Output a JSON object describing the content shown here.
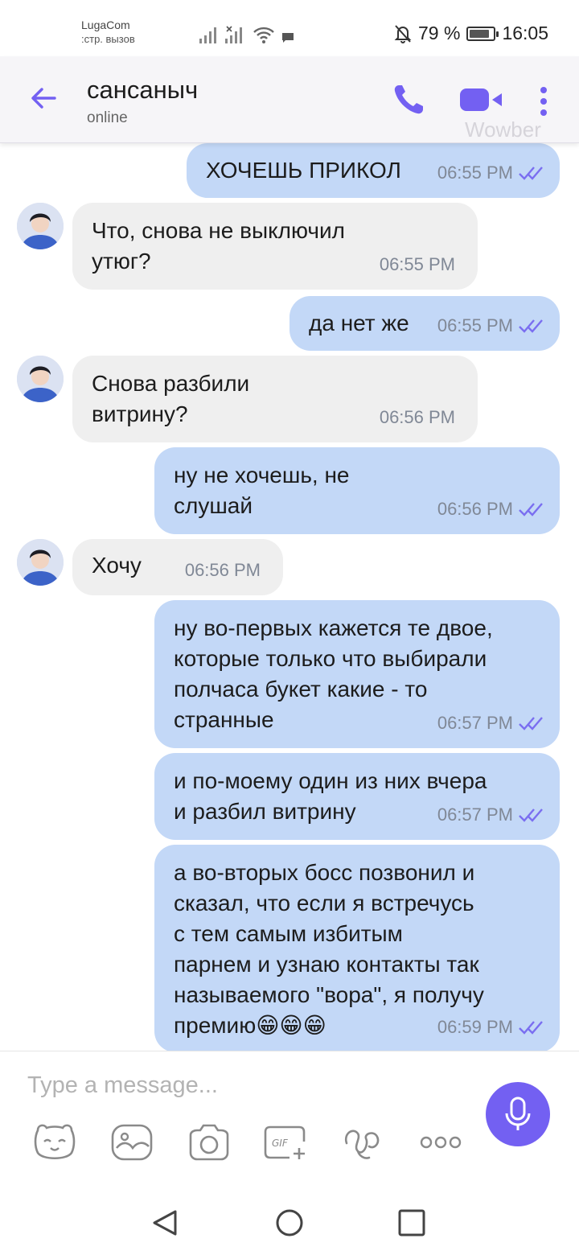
{
  "status_bar": {
    "carrier": "LugaCom",
    "carrier_sub": ":стр. вызов",
    "battery": "79 %",
    "time": "16:05"
  },
  "header": {
    "contact_name": "сансаныч",
    "status": "online",
    "watermark": "Wowber"
  },
  "messages": [
    {
      "direction": "out",
      "text": "ХОЧЕШЬ ПРИКОЛ",
      "time": "06:55 PM",
      "read": true
    },
    {
      "direction": "in",
      "text": "Что, снова не выключил\nутюг?",
      "time": "06:55 PM"
    },
    {
      "direction": "out",
      "text": "да нет же",
      "time": "06:55 PM",
      "read": true
    },
    {
      "direction": "in",
      "text": "Снова разбили\nвитрину?",
      "time": "06:56 PM"
    },
    {
      "direction": "out",
      "text": "ну не хочешь, не\nслушай",
      "time": "06:56 PM",
      "read": true
    },
    {
      "direction": "in",
      "text": "Хочу",
      "time": "06:56 PM"
    },
    {
      "direction": "out",
      "text": "ну во-первых кажется те двое,\nкоторые только что выбирали\nполчаса букет какие - то\nстранные",
      "time": "06:57 PM",
      "read": true
    },
    {
      "direction": "out",
      "text": "и по-моему один из них вчера\nи разбил витрину",
      "time": "06:57 PM",
      "read": true
    },
    {
      "direction": "out",
      "text": "а во-вторых босс позвонил и\nсказал, что если я встречусь\nс тем самым избитым\nпарнем и  узнаю контакты так\nназываемого \"вора\", я получу\nпремию😁😁😁",
      "time": "06:59 PM",
      "read": true
    }
  ],
  "composer": {
    "placeholder": "Type a message..."
  },
  "icons": {
    "toolbar": [
      "sticker-icon",
      "gallery-icon",
      "camera-icon",
      "gif-icon",
      "doodle-icon",
      "more-icon"
    ],
    "nav": [
      "back-triangle-icon",
      "home-circle-icon",
      "recents-square-icon"
    ]
  },
  "colors": {
    "accent": "#7360f2",
    "outgoing_bubble": "#c3d8f7",
    "incoming_bubble": "#efefef"
  }
}
